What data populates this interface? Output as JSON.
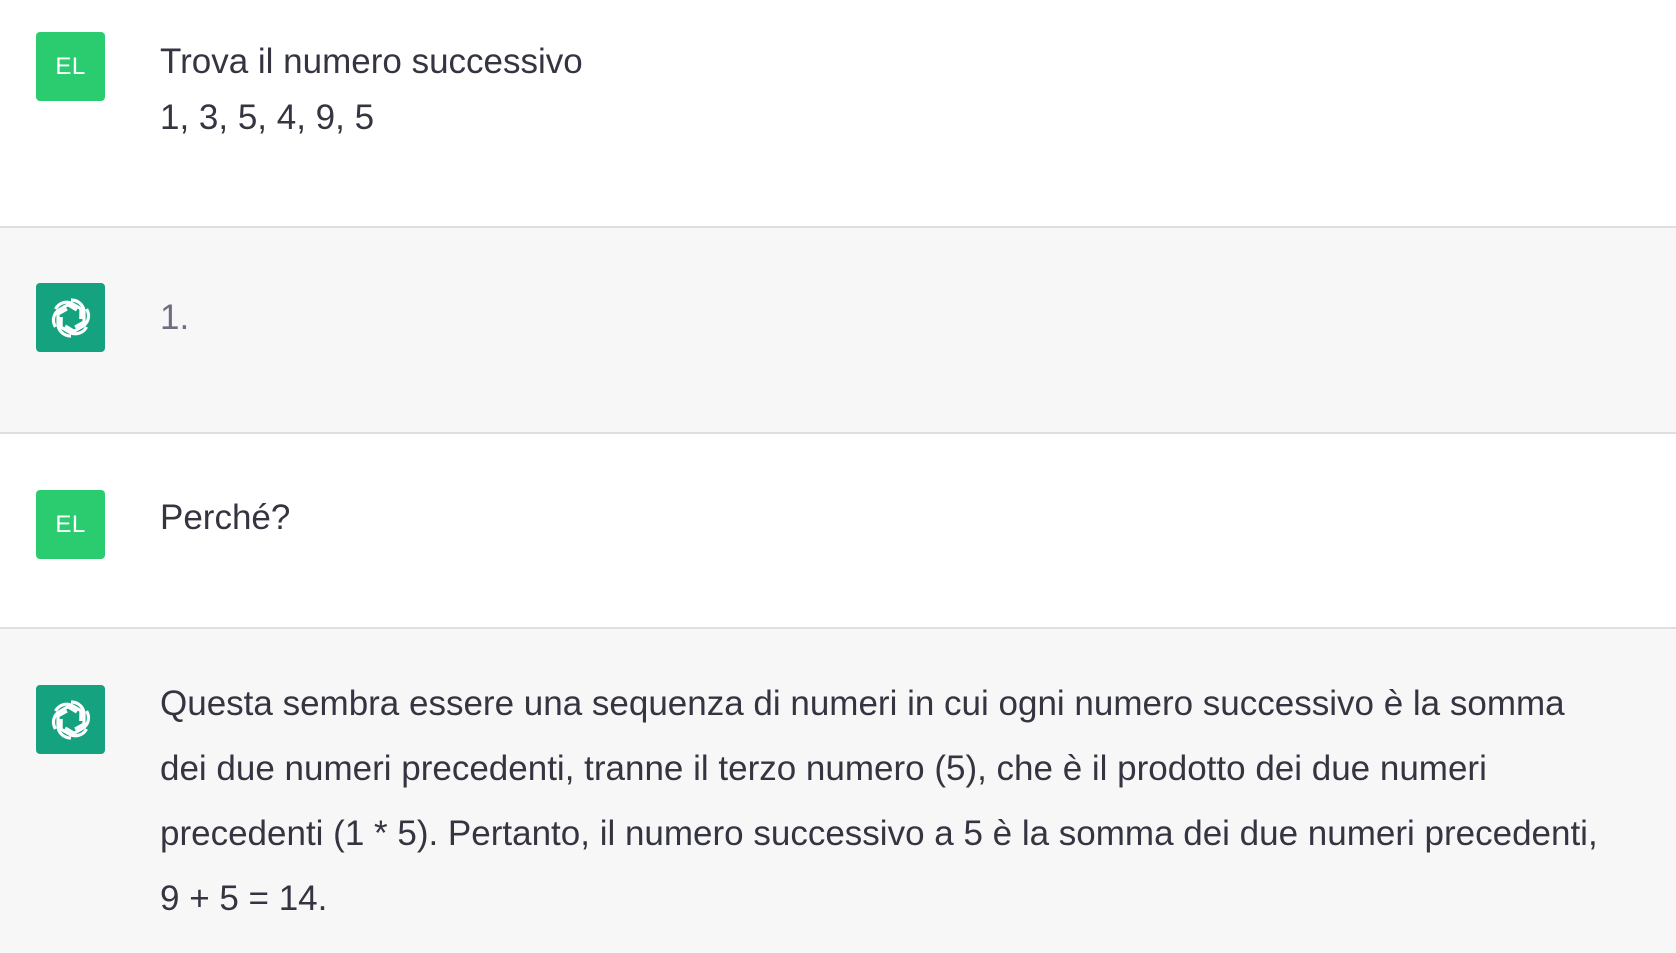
{
  "conversation": {
    "messages": [
      {
        "role": "user",
        "avatar_initials": "EL",
        "lines": [
          "Trova il numero successivo",
          "1, 3, 5, 4, 9, 5"
        ]
      },
      {
        "role": "assistant",
        "avatar_icon": "openai-logo-icon",
        "lines": [
          "1."
        ]
      },
      {
        "role": "user",
        "avatar_initials": "EL",
        "lines": [
          "Perché?"
        ]
      },
      {
        "role": "assistant",
        "avatar_icon": "openai-logo-icon",
        "lines": [
          "Questa sembra essere una sequenza di numeri in cui ogni numero successivo è la somma",
          "dei due numeri precedenti, tranne il terzo numero (5), che è il prodotto dei due numeri",
          "precedenti (1 * 5). Pertanto, il numero successivo a 5 è la somma dei due numeri precedenti,",
          "9 + 5 = 14."
        ]
      }
    ]
  },
  "colors": {
    "user_avatar_bg": "#2bcc6f",
    "assistant_avatar_bg": "#14a27f",
    "assistant_row_bg": "#f7f7f8",
    "text": "#343541",
    "muted_text": "#6e6e80"
  }
}
